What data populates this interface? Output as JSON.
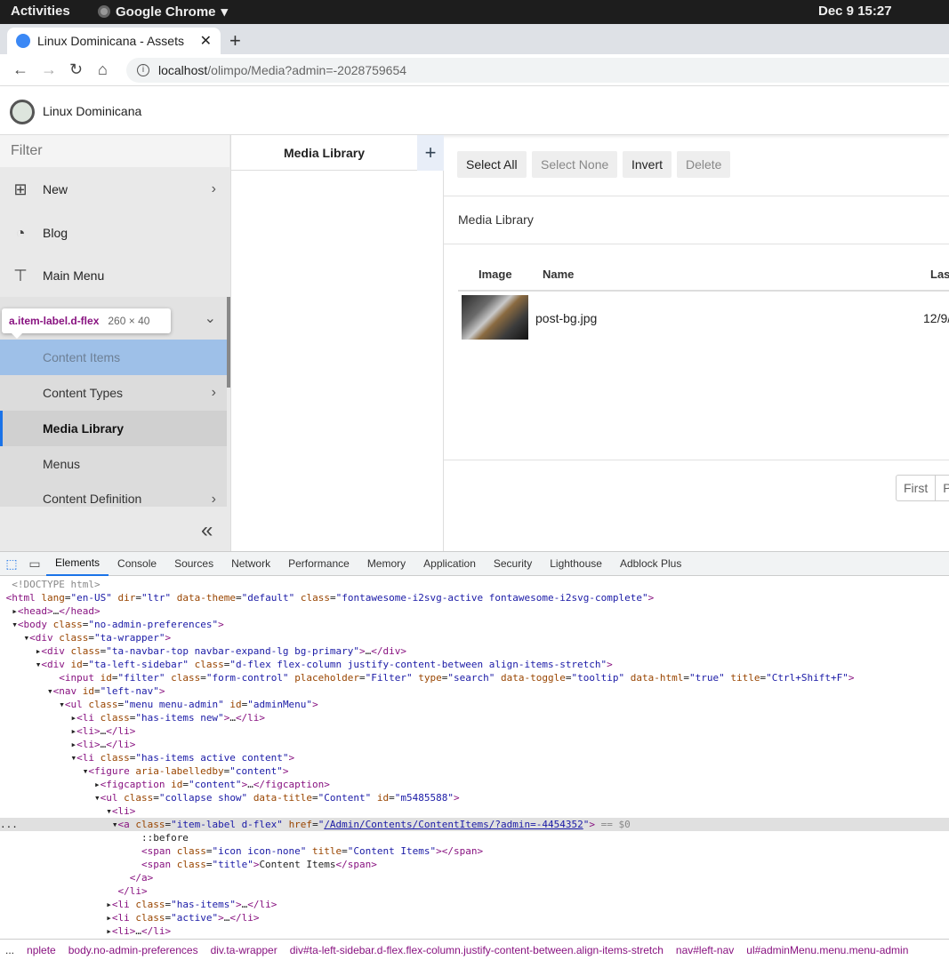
{
  "system": {
    "activities": "Activities",
    "app_name": "Google Chrome",
    "clock": "Dec 9  15:27"
  },
  "browser": {
    "tab_title": "Linux Dominicana - Assets",
    "new_tab": "+",
    "url_host": "localhost",
    "url_path": "/olimpo/Media?admin=-2028759654"
  },
  "app": {
    "brand": "Linux Dominicana"
  },
  "sidebar": {
    "filter_placeholder": "Filter",
    "items": [
      {
        "label": "New",
        "icon": "plus-square-icon"
      },
      {
        "label": "Blog",
        "icon": "rss-icon"
      },
      {
        "label": "Main Menu",
        "icon": "sitemap-icon"
      }
    ],
    "subitems": [
      {
        "label": "Content Items"
      },
      {
        "label": "Content Types"
      },
      {
        "label": "Media Library"
      },
      {
        "label": "Menus"
      },
      {
        "label": "Content Definition"
      }
    ],
    "tooltip_selector": "a.item-label.d-flex",
    "tooltip_dims": "260 × 40"
  },
  "media_panel": {
    "title": "Media Library",
    "add": "+"
  },
  "main": {
    "buttons": {
      "select_all": "Select All",
      "select_none": "Select None",
      "invert": "Invert",
      "delete": "Delete"
    },
    "card_title": "Media Library",
    "columns": [
      "Image",
      "Name",
      "Las"
    ],
    "rows": [
      {
        "name": "post-bg.jpg",
        "date": "12/9/"
      }
    ],
    "pager": [
      "First",
      "P"
    ]
  },
  "devtools": {
    "tabs": [
      "Elements",
      "Console",
      "Sources",
      "Network",
      "Performance",
      "Memory",
      "Application",
      "Security",
      "Lighthouse",
      "Adblock Plus"
    ],
    "breadcrumbs": [
      "nplete",
      "body.no-admin-preferences",
      "div.ta-wrapper",
      "div#ta-left-sidebar.d-flex.flex-column.justify-content-between.align-items-stretch",
      "nav#left-nav",
      "ul#adminMenu.menu.menu-admin"
    ],
    "ellipsis": "..."
  }
}
